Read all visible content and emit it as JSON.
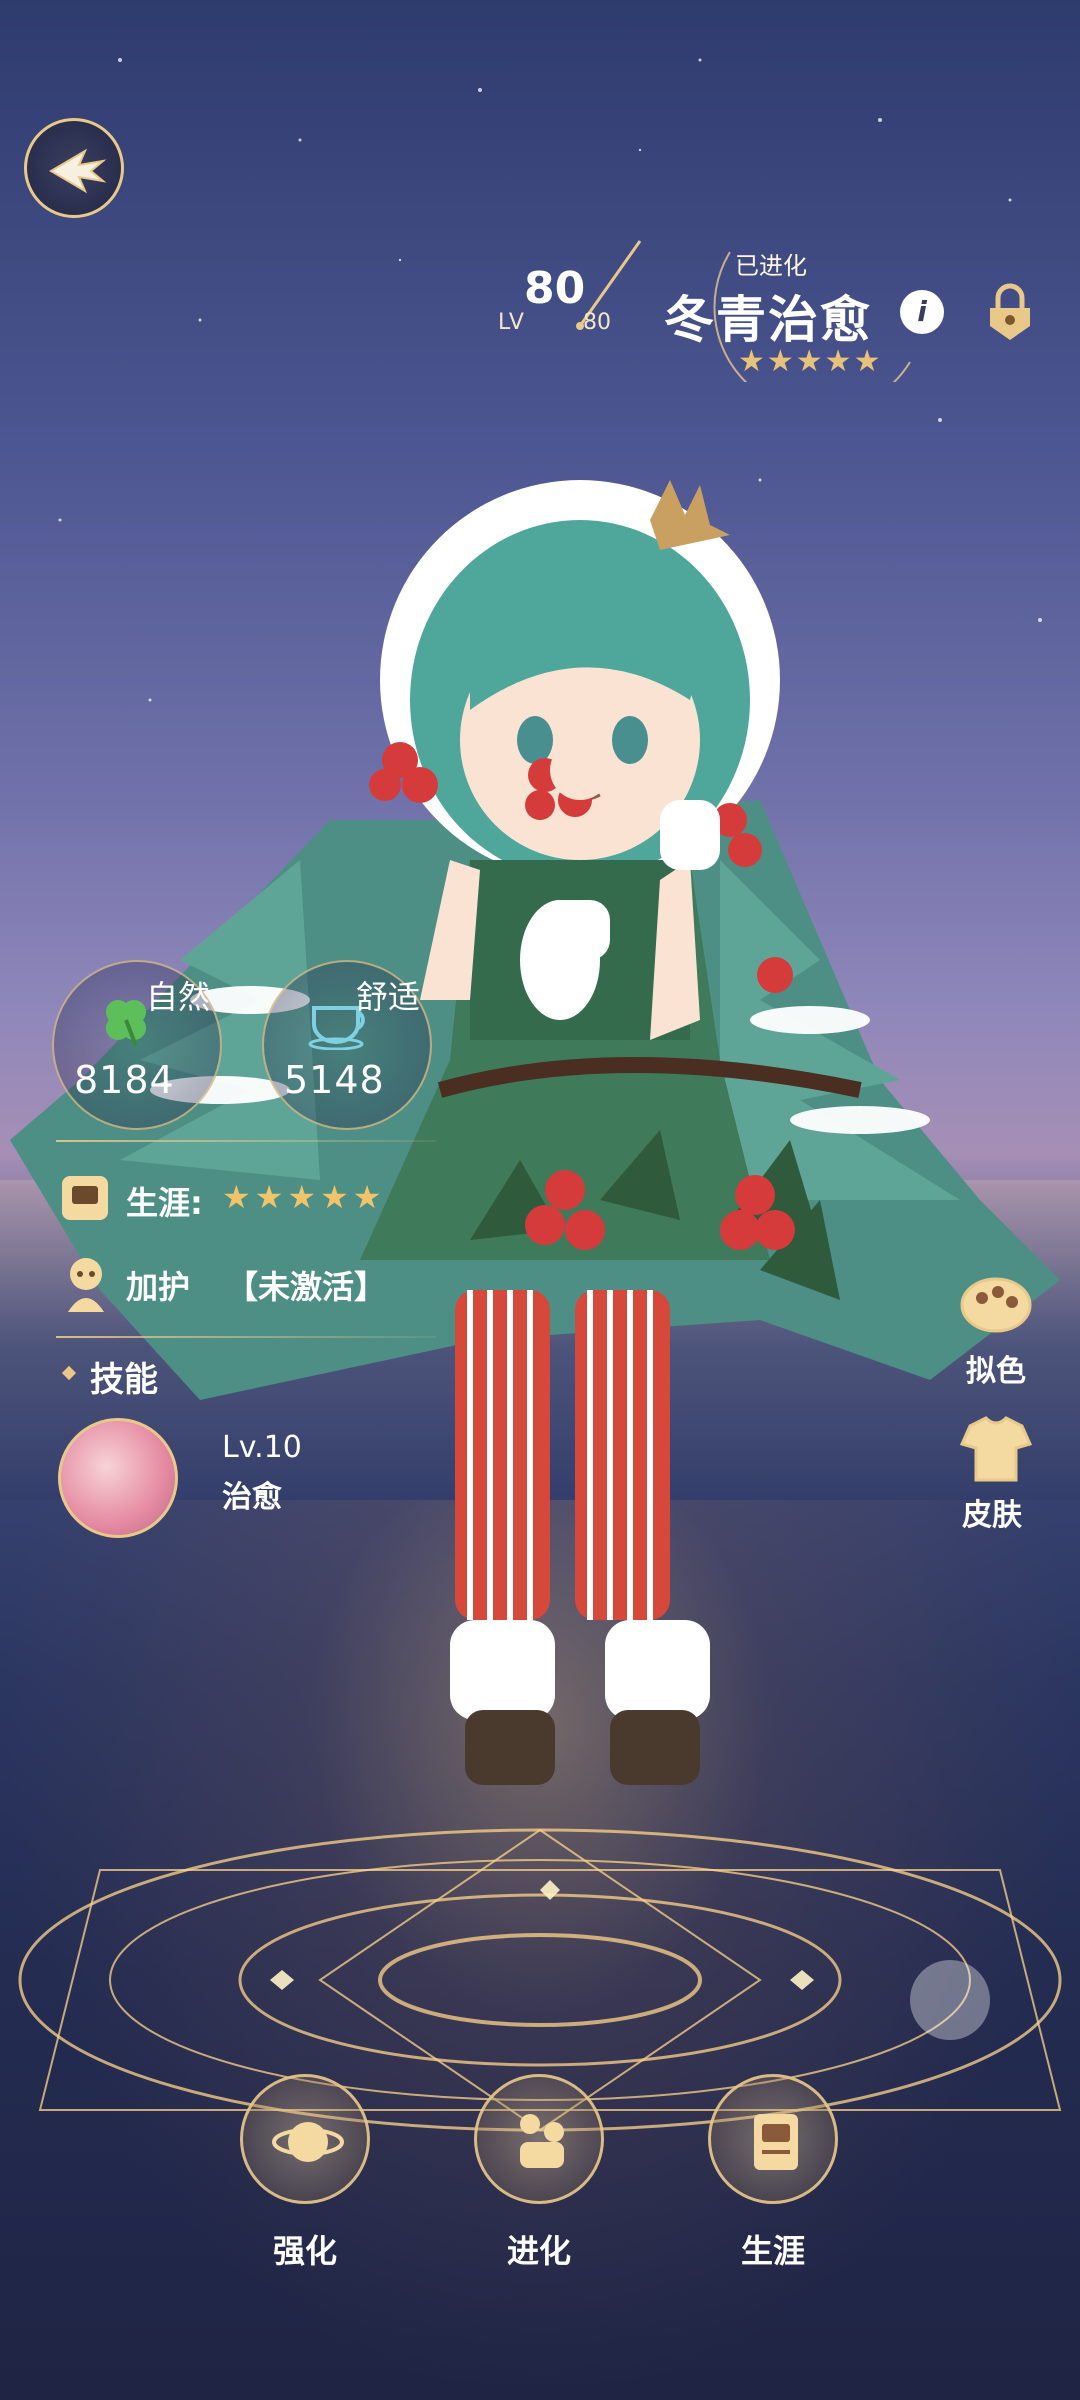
{
  "header": {
    "level": "80",
    "level_label": "LV",
    "level_max": "80",
    "evolved_tag": "已进化",
    "character_name": "冬青治愈",
    "rarity_stars": "★★★★★",
    "info_icon": "i"
  },
  "stats": [
    {
      "label": "自然",
      "value": "8184",
      "icon": "clover-icon"
    },
    {
      "label": "舒适",
      "value": "5148",
      "icon": "teacup-icon"
    }
  ],
  "career": {
    "label": "生涯:",
    "stars": "★★★★★"
  },
  "protection": {
    "label": "加护",
    "status": "【未激活】"
  },
  "skills": {
    "title": "技能",
    "level": "Lv.10",
    "name": "治愈"
  },
  "side_actions": [
    {
      "label": "拟色",
      "icon": "dye-icon"
    },
    {
      "label": "皮肤",
      "icon": "skin-icon"
    }
  ],
  "bottom_actions": [
    {
      "label": "强化",
      "icon": "enhance-icon"
    },
    {
      "label": "进化",
      "icon": "evolve-icon"
    },
    {
      "label": "生涯",
      "icon": "career-icon"
    }
  ],
  "colors": {
    "accent_gold": "#e9c98a",
    "star_gold": "#e8c27a",
    "sky_top": "#2e3b6d",
    "sky_horizon": "#a58fb5"
  }
}
